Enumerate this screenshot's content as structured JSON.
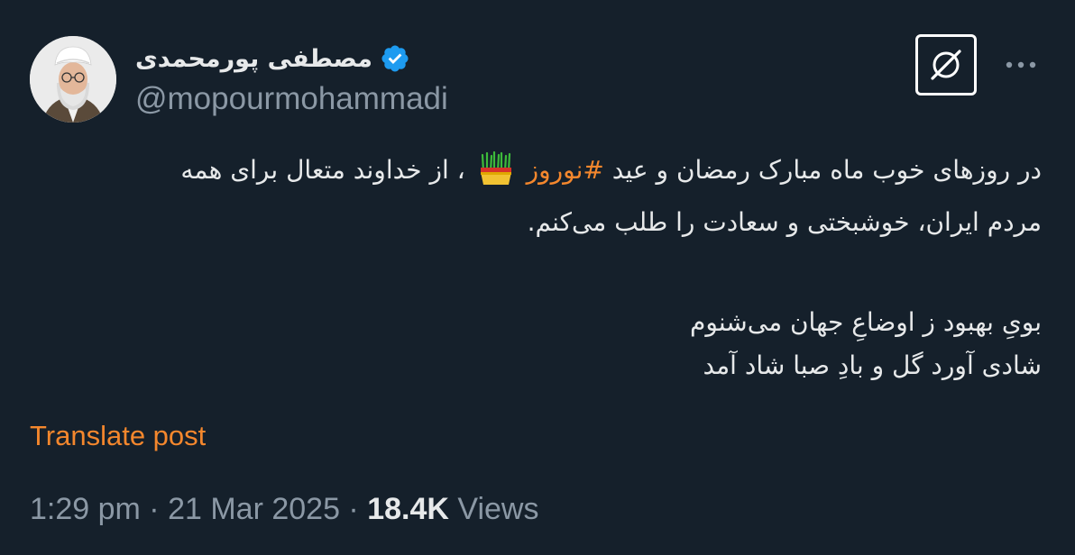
{
  "author": {
    "display_name": "مصطفی پورمحمدی",
    "handle": "@mopourmohammadi",
    "verified": true,
    "verified_badge_color": "#1d9bf0"
  },
  "post": {
    "line1": {
      "before_hashtag": "در روزهای خوب ماه مبارک رمضان و عید",
      "hashtag": "#نوروز",
      "emoji_icon": "sabzeh-icon",
      "after_hashtag": "، از خداوند متعال برای همه"
    },
    "line2": "مردم ایران، خوشبختی و سعادت را طلب می‌کنم.",
    "poem": [
      "بویِ بهبود ز اوضاعِ جهان می‌شنوم",
      "شادی آورد گل و بادِ صبا شاد آمد"
    ]
  },
  "actions": {
    "translate_label": "Translate post",
    "grok_icon": "grok-icon",
    "more_icon": "more-icon"
  },
  "meta": {
    "time": "1:29 pm",
    "separator": " · ",
    "date": "21 Mar 2025",
    "views_count": "18.4K",
    "views_label": " Views"
  },
  "colors": {
    "background": "#15202b",
    "text": "#e7e9ea",
    "secondary_text": "#8b98a5",
    "accent": "#f4872d"
  }
}
